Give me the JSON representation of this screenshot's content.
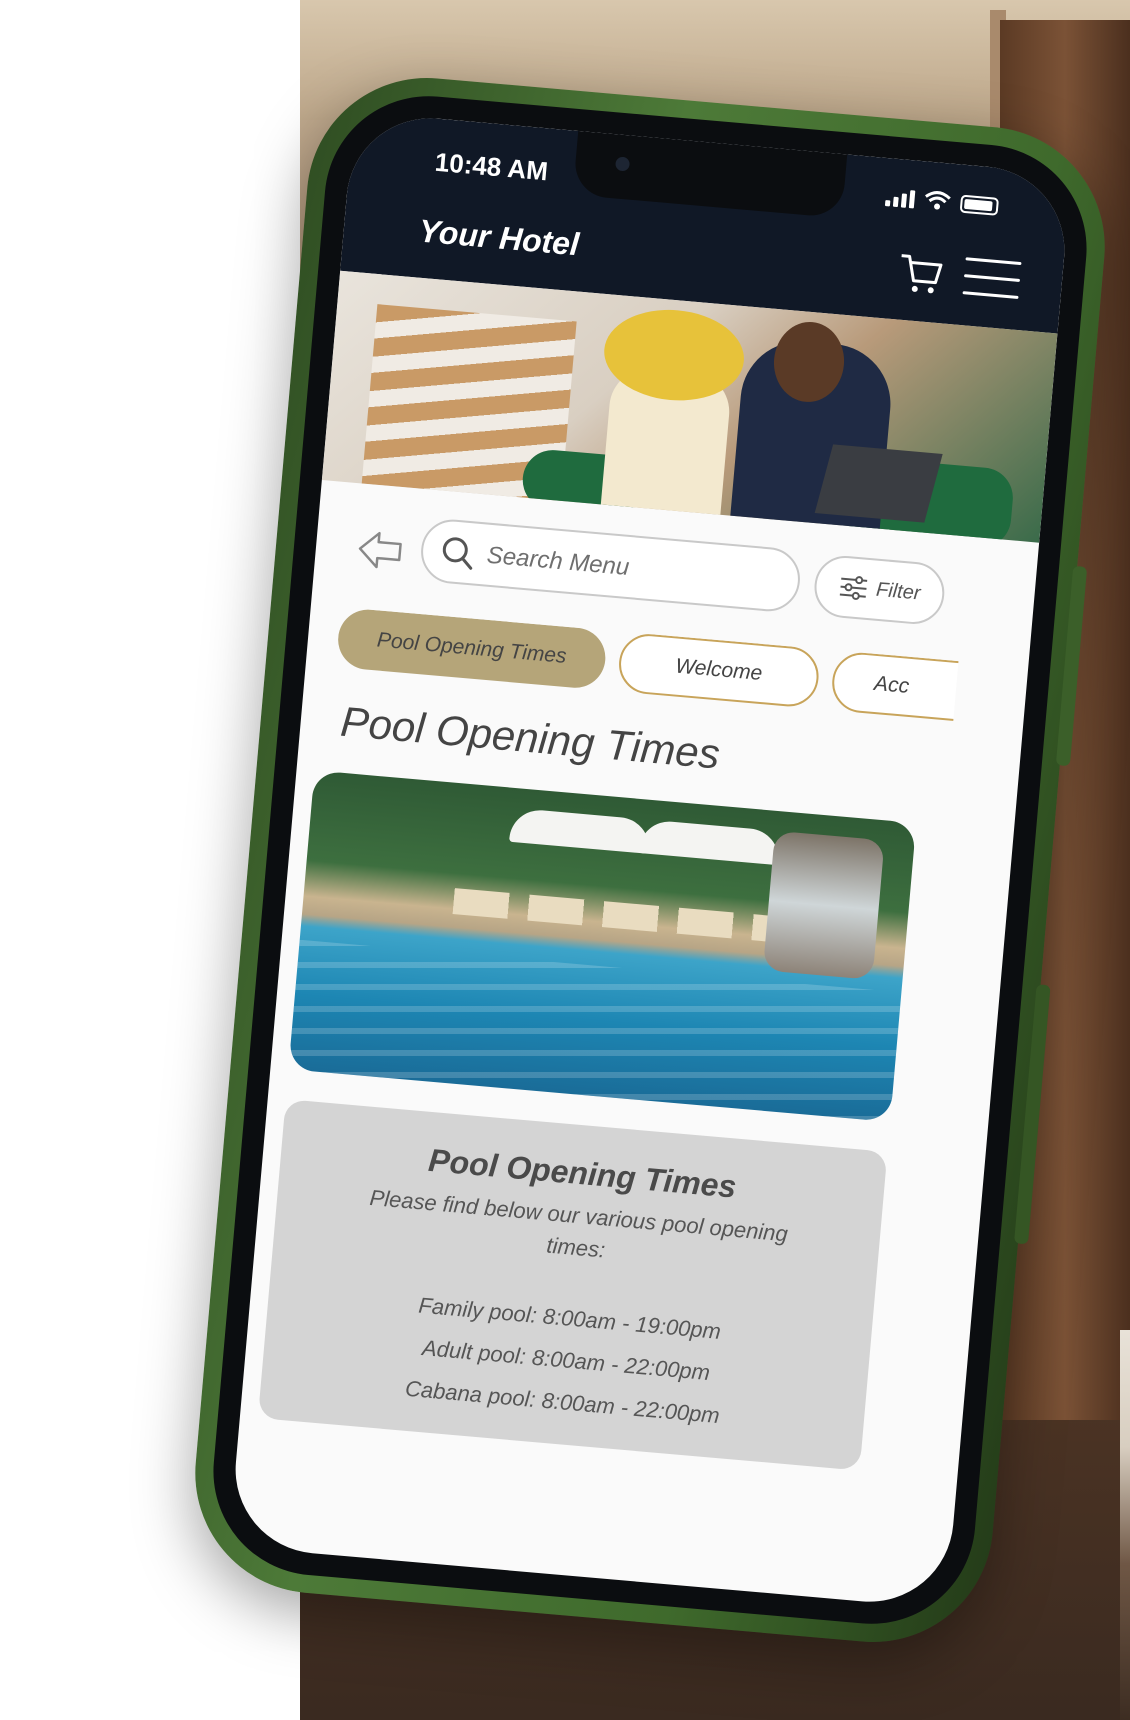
{
  "status_bar": {
    "time": "10:48 AM"
  },
  "header": {
    "title": "Your Hotel"
  },
  "search": {
    "placeholder": "Search Menu"
  },
  "filter": {
    "label": "Filter"
  },
  "tabs": [
    {
      "label": "Pool Opening Times",
      "active": true
    },
    {
      "label": "Welcome",
      "active": false
    },
    {
      "label": "Acc",
      "active": false
    }
  ],
  "section": {
    "title": "Pool Opening Times"
  },
  "info_card": {
    "title": "Pool Opening Times",
    "intro": "Please find below our various pool opening times:",
    "lines": [
      "Family pool: 8:00am - 19:00pm",
      "Adult pool: 8:00am - 22:00pm",
      "Cabana pool: 8:00am - 22:00pm"
    ]
  },
  "colors": {
    "header_bg": "#101826",
    "tab_active": "#b5a579",
    "tab_border": "#c8a45a",
    "card_bg": "#d4d4d4",
    "phone_frame": "#4d7a38"
  },
  "icons": [
    "back-arrow-icon",
    "search-icon",
    "filter-icon",
    "cart-icon",
    "hamburger-menu-icon",
    "signal-icon",
    "wifi-icon",
    "battery-icon"
  ]
}
